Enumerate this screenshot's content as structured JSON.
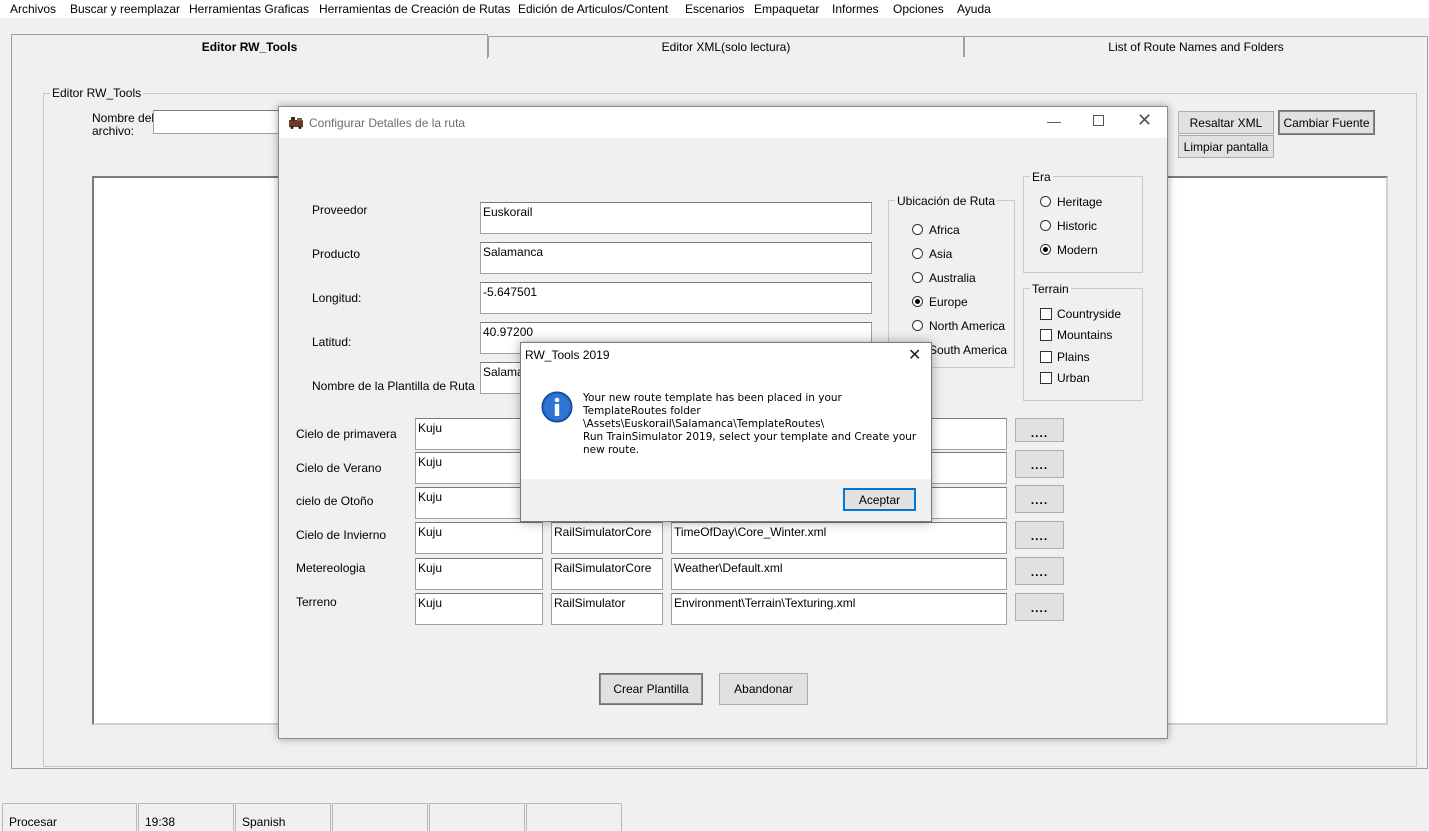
{
  "menu": [
    "Archivos",
    "Buscar y reemplazar",
    "Herramientas Graficas",
    "Herramientas de Creación de Rutas",
    "Edición de Articulos/Content",
    "Escenarios",
    "Empaquetar",
    "Informes",
    "Opciones",
    "Ayuda"
  ],
  "tabs": {
    "editor": "Editor RW_Tools",
    "xml": "Editor XML(solo lectura)",
    "routes": "List of Route Names and Folders"
  },
  "editor_panel": {
    "group_title": "Editor RW_Tools",
    "filename_label_1": "Nombre del",
    "filename_label_2": "archivo:",
    "btn_resaltar": "Resaltar XML",
    "btn_cambiar_fuente": "Cambiar Fuente",
    "btn_limpiar": "Limpiar pantalla"
  },
  "status_bar": {
    "state": "Procesar",
    "time": "19:38",
    "language": "Spanish"
  },
  "dialog": {
    "title": "Configurar Detalles de la ruta",
    "fields": {
      "proveedor_label": "Proveedor",
      "proveedor_value": "Euskorail",
      "producto_label": "Producto",
      "producto_value": "Salamanca",
      "longitud_label": "Longitud:",
      "longitud_value": "-5.647501",
      "latitud_label": "Latitud:",
      "latitud_value": "40.97200",
      "plantilla_label": "Nombre de la Plantilla de Ruta",
      "plantilla_value": "Salamanca"
    },
    "ubicacion": {
      "title": "Ubicación de Ruta",
      "options": [
        "Africa",
        "Asia",
        "Australia",
        "Europe",
        "North America",
        "South America"
      ],
      "selected": "Europe"
    },
    "era": {
      "title": "Era",
      "options": [
        "Heritage",
        "Historic",
        "Modern"
      ],
      "selected": "Modern"
    },
    "terrain": {
      "title": "Terrain",
      "options": [
        "Countryside",
        "Mountains",
        "Plains",
        "Urban"
      ]
    },
    "rows": [
      {
        "label": "Cielo de primavera",
        "provider": "Kuju",
        "product": "",
        "path": ""
      },
      {
        "label": "Cielo de Verano",
        "provider": "Kuju",
        "product": "",
        "path": ""
      },
      {
        "label": "cielo de Otoño",
        "provider": "Kuju",
        "product": "",
        "path": ""
      },
      {
        "label": "Cielo de Invierno",
        "provider": "Kuju",
        "product": "RailSimulatorCore",
        "path": "TimeOfDay\\Core_Winter.xml"
      },
      {
        "label": "Metereologia",
        "provider": "Kuju",
        "product": "RailSimulatorCore",
        "path": "Weather\\Default.xml"
      },
      {
        "label": "Terreno",
        "provider": "Kuju",
        "product": "RailSimulator",
        "path": "Environment\\Terrain\\Texturing.xml"
      }
    ],
    "browse_label": "....",
    "btn_crear": "Crear Plantilla",
    "btn_abandonar": "Abandonar"
  },
  "msgbox": {
    "title": "RW_Tools 2019",
    "line1": "Your new route template has been placed in your",
    "line2": "TemplateRoutes folder",
    "line3": "\\Assets\\Euskorail\\Salamanca\\TemplateRoutes\\",
    "line4": "Run TrainSimulator 2019, select your template and Create your",
    "line5": "new route.",
    "ok": "Aceptar"
  },
  "colors": {
    "info_icon": "#1f5fbf",
    "window_bg": "#f0f0f0"
  }
}
